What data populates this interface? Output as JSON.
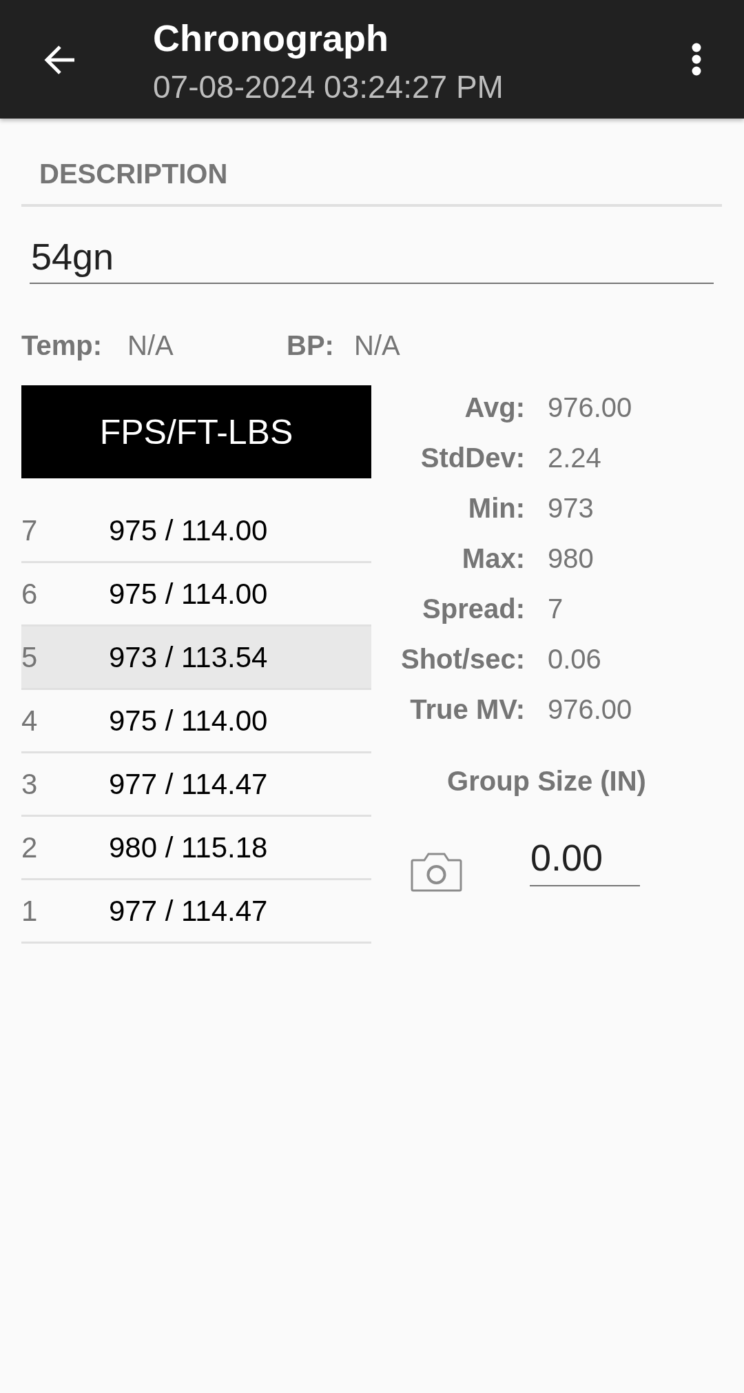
{
  "app_bar": {
    "title": "Chronograph",
    "subtitle": "07-08-2024 03:24:27 PM"
  },
  "description": {
    "label": "DESCRIPTION",
    "value": "54gn"
  },
  "conditions": [
    {
      "label": "Temp:",
      "value": "N/A"
    },
    {
      "label": "BP:",
      "value": "N/A"
    }
  ],
  "units_button": {
    "label": "FPS/FT-LBS"
  },
  "shots": [
    {
      "number": "7",
      "reading": "975 / 114.00",
      "selected": false
    },
    {
      "number": "6",
      "reading": "975 / 114.00",
      "selected": false
    },
    {
      "number": "5",
      "reading": "973 / 113.54",
      "selected": true
    },
    {
      "number": "4",
      "reading": "975 / 114.00",
      "selected": false
    },
    {
      "number": "3",
      "reading": "977 / 114.47",
      "selected": false
    },
    {
      "number": "2",
      "reading": "980 / 115.18",
      "selected": false
    },
    {
      "number": "1",
      "reading": "977 / 114.47",
      "selected": false
    }
  ],
  "stats": [
    {
      "label": "Avg:",
      "value": "976.00"
    },
    {
      "label": "StdDev:",
      "value": "2.24"
    },
    {
      "label": "Min:",
      "value": "973"
    },
    {
      "label": "Max:",
      "value": "980"
    },
    {
      "label": "Spread:",
      "value": "7"
    },
    {
      "label": "Shot/sec:",
      "value": "0.06"
    },
    {
      "label": "True MV:",
      "value": "976.00"
    }
  ],
  "group_size": {
    "label": "Group Size (IN)",
    "value": "0.00"
  }
}
